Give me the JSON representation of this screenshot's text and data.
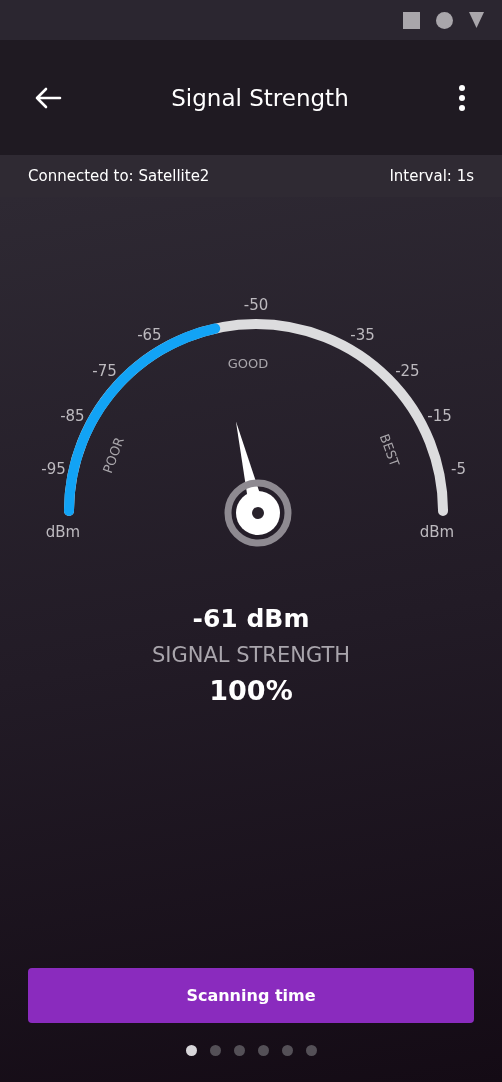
{
  "header": {
    "title": "Signal Strength"
  },
  "connection_bar": {
    "connected": "Connected to: Satellite2",
    "interval": "Interval: 1s"
  },
  "gauge": {
    "unit_left": "dBm",
    "unit_right": "dBm",
    "ticks": [
      "-95",
      "-85",
      "-75",
      "-65",
      "-50",
      "-35",
      "-25",
      "-15",
      "-5"
    ],
    "zones": [
      {
        "kind": "poor",
        "label": "POOR"
      },
      {
        "kind": "good",
        "label": "GOOD"
      },
      {
        "kind": "best",
        "label": "BEST"
      }
    ]
  },
  "reading": {
    "value": "-61 dBm",
    "label": "SIGNAL STRENGTH",
    "percent": "100%"
  },
  "button": {
    "label": "Scanning time"
  },
  "pages": [
    {
      "selected": true
    },
    {
      "selected": false
    },
    {
      "selected": false
    },
    {
      "selected": false
    },
    {
      "selected": false
    },
    {
      "selected": false
    }
  ]
}
